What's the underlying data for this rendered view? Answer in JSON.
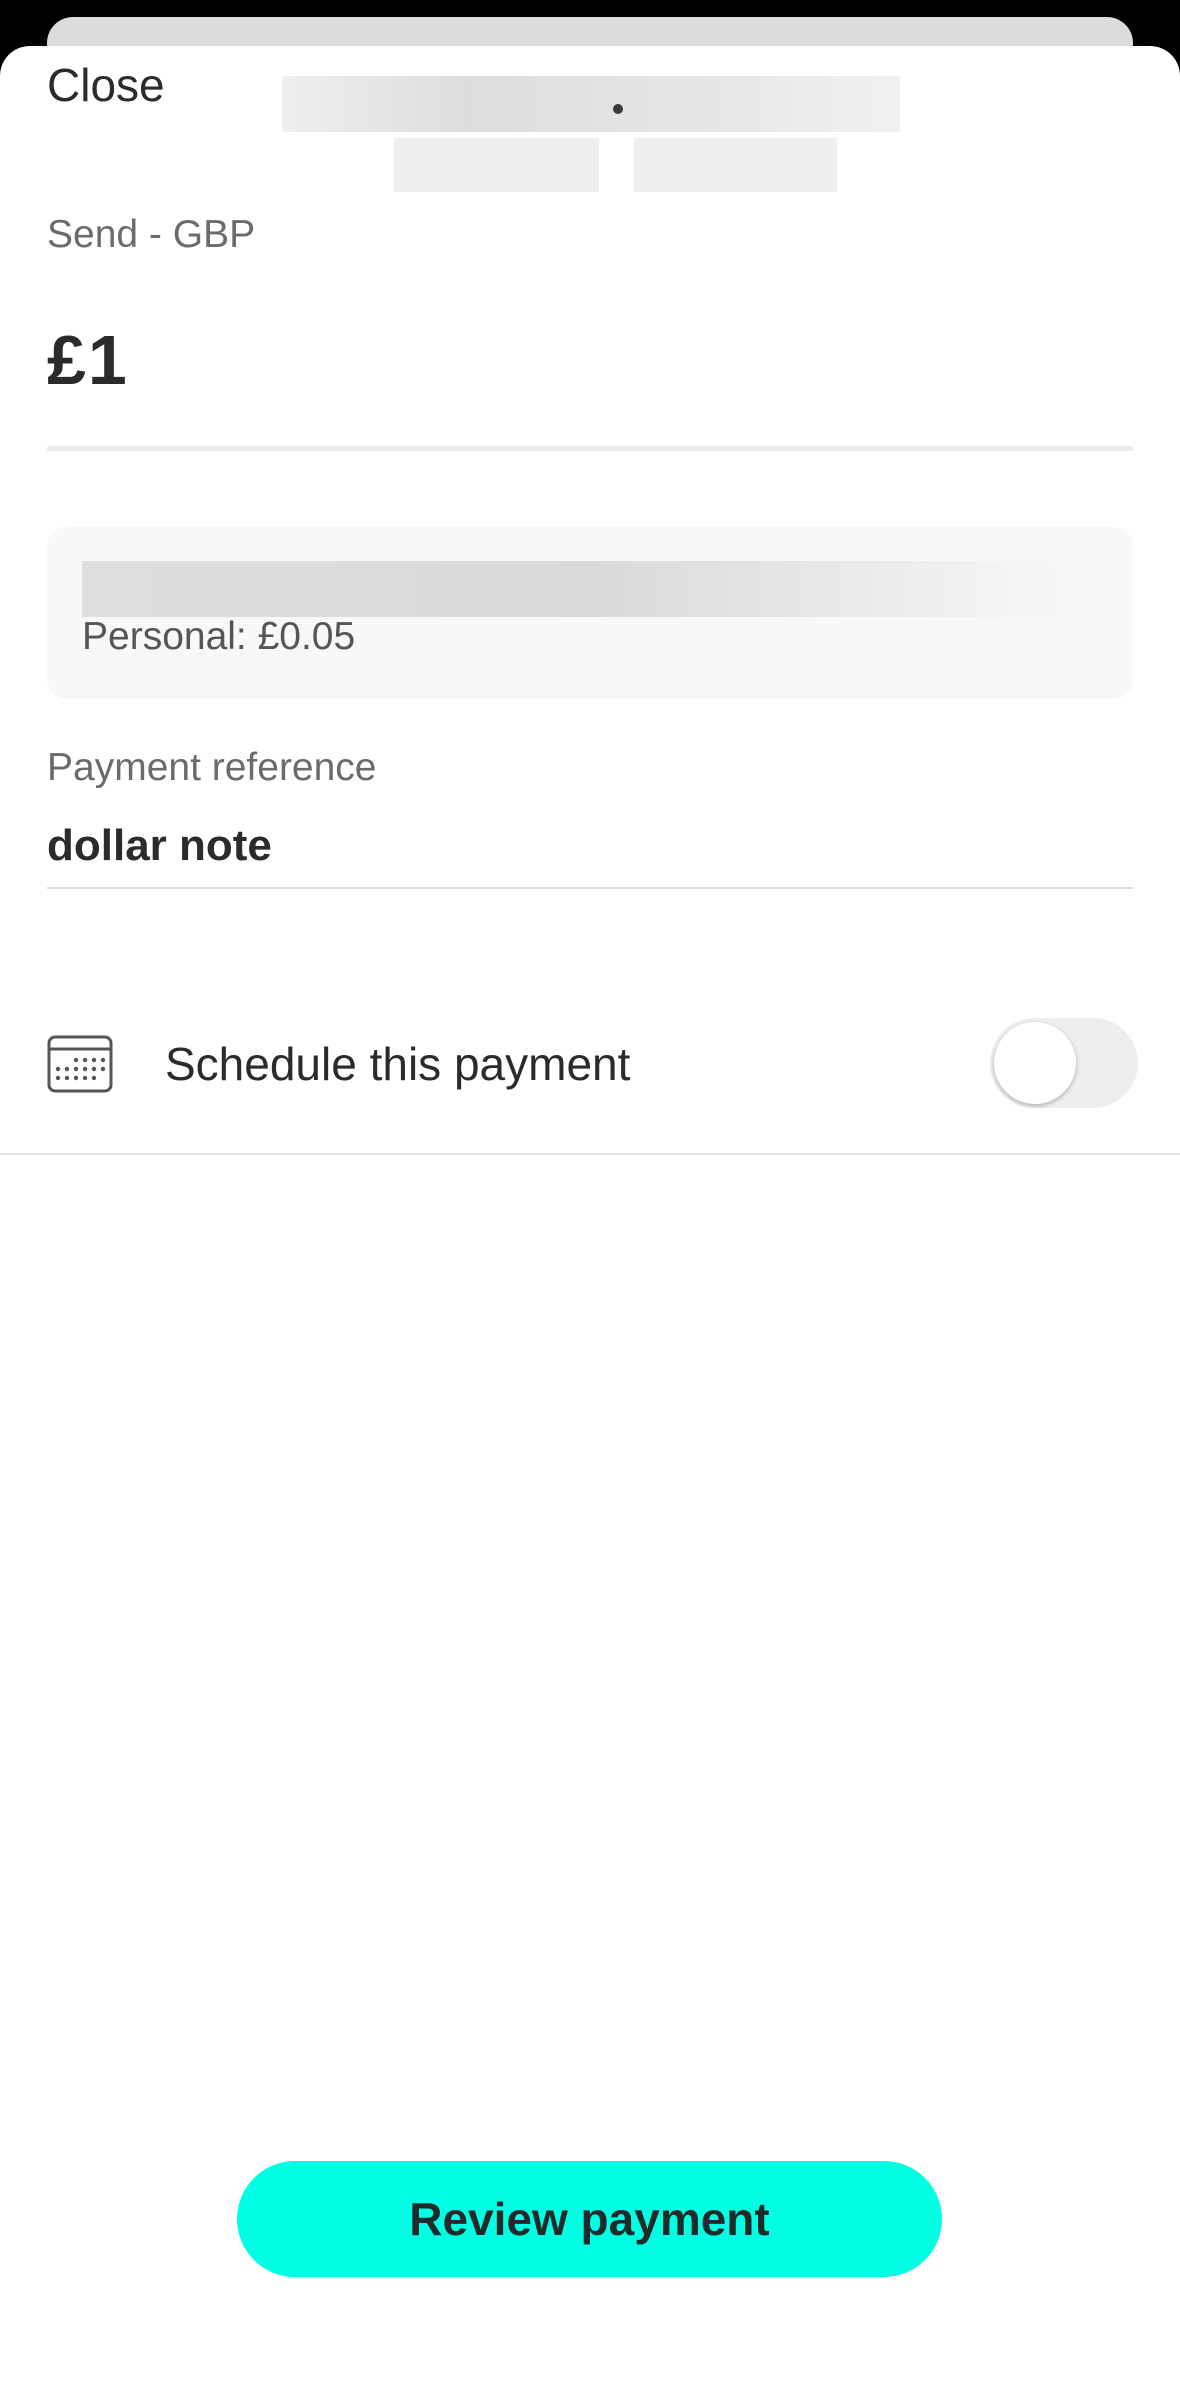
{
  "header": {
    "close_label": "Close"
  },
  "send": {
    "label": "Send - GBP",
    "amount": "£1"
  },
  "fee": {
    "text": "Personal: £0.05"
  },
  "reference": {
    "label": "Payment reference",
    "value": "dollar note"
  },
  "schedule": {
    "label": "Schedule this payment",
    "icon": "calendar-icon",
    "enabled": false
  },
  "footer": {
    "review_label": "Review payment"
  },
  "colors": {
    "accent": "#00ffe3",
    "text": "#2b2b2b",
    "muted": "#6b6b6b"
  }
}
